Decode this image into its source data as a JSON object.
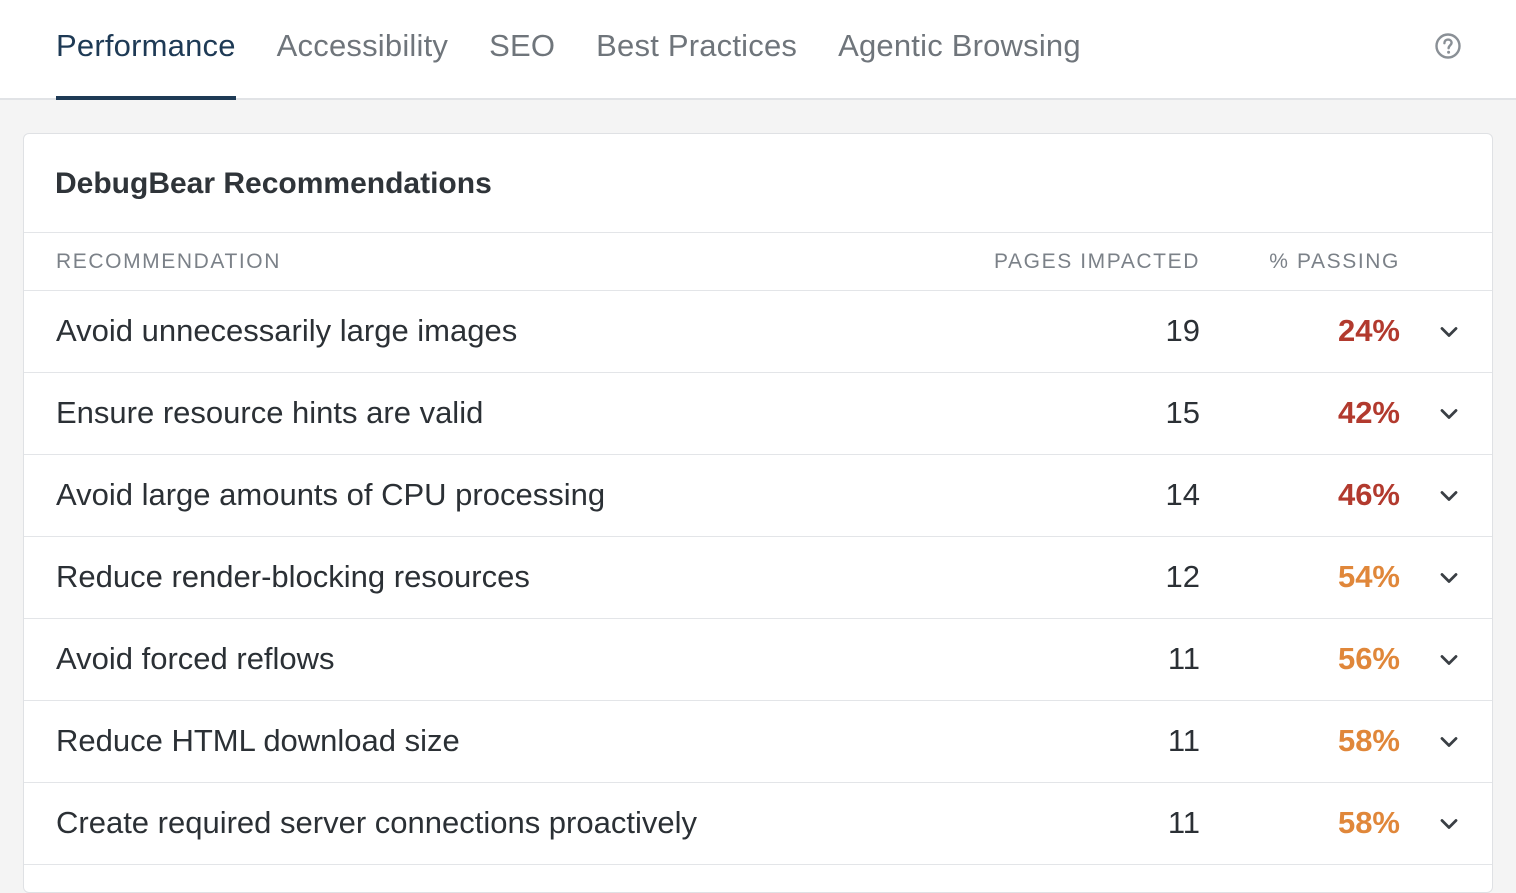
{
  "tabs": [
    {
      "label": "Performance",
      "active": true
    },
    {
      "label": "Accessibility",
      "active": false
    },
    {
      "label": "SEO",
      "active": false
    },
    {
      "label": "Best Practices",
      "active": false
    },
    {
      "label": "Agentic Browsing",
      "active": false
    }
  ],
  "help_icon": "question-circle-icon",
  "card": {
    "title": "DebugBear Recommendations",
    "columns": {
      "recommendation": "RECOMMENDATION",
      "pages_impacted": "PAGES IMPACTED",
      "passing": "% PASSING"
    },
    "rows": [
      {
        "recommendation": "Avoid unnecessarily large images",
        "pages": "19",
        "passing": "24%",
        "status": "red"
      },
      {
        "recommendation": "Ensure resource hints are valid",
        "pages": "15",
        "passing": "42%",
        "status": "red"
      },
      {
        "recommendation": "Avoid large amounts of CPU processing",
        "pages": "14",
        "passing": "46%",
        "status": "red"
      },
      {
        "recommendation": "Reduce render-blocking resources",
        "pages": "12",
        "passing": "54%",
        "status": "orange"
      },
      {
        "recommendation": "Avoid forced reflows",
        "pages": "11",
        "passing": "56%",
        "status": "orange"
      },
      {
        "recommendation": "Reduce HTML download size",
        "pages": "11",
        "passing": "58%",
        "status": "orange"
      },
      {
        "recommendation": "Create required server connections proactively",
        "pages": "11",
        "passing": "58%",
        "status": "orange"
      }
    ]
  },
  "colors": {
    "accent": "#1e3a55",
    "bad": "#b23a2e",
    "warn": "#e0873a"
  }
}
